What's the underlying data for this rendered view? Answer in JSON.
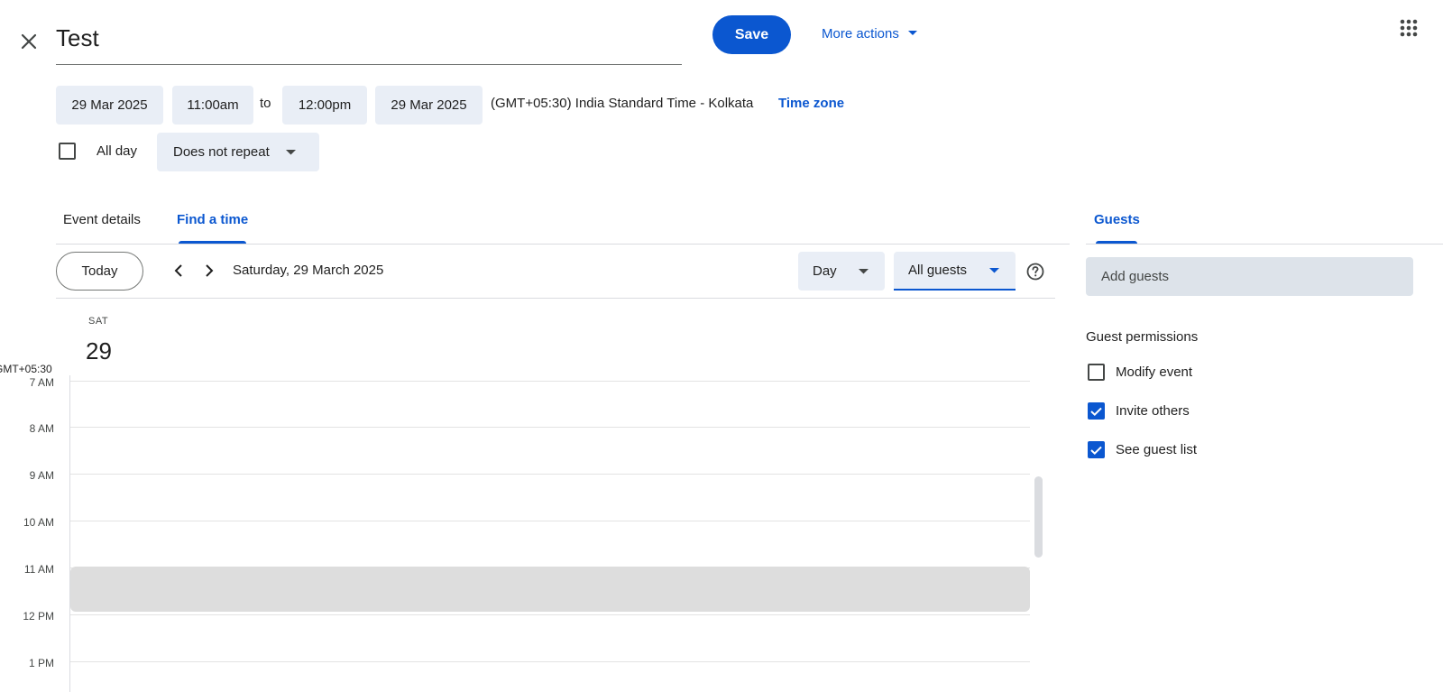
{
  "header": {
    "title_value": "Test",
    "save_label": "Save",
    "more_actions_label": "More actions"
  },
  "datetime": {
    "start_date": "29 Mar 2025",
    "start_time": "11:00am",
    "to_label": "to",
    "end_time": "12:00pm",
    "end_date": "29 Mar 2025",
    "timezone_text": "(GMT+05:30) India Standard Time - Kolkata",
    "timezone_link": "Time zone",
    "all_day_label": "All day",
    "all_day_checked": false,
    "repeat_value": "Does not repeat"
  },
  "tabs": [
    {
      "label": "Event details",
      "active": false
    },
    {
      "label": "Find a time",
      "active": true
    }
  ],
  "toolbar": {
    "today_label": "Today",
    "date_heading": "Saturday, 29 March 2025",
    "view_value": "Day",
    "guests_filter_value": "All guests"
  },
  "day_view": {
    "day_abbr": "SAT",
    "day_number": "29",
    "timezone_label": "GMT+05:30",
    "hours": [
      "7 AM",
      "8 AM",
      "9 AM",
      "10 AM",
      "11 AM",
      "12 PM",
      "1 PM"
    ],
    "busy_block": {
      "start": "11 AM",
      "end": "12 PM"
    }
  },
  "guests_panel": {
    "tab_label": "Guests",
    "add_guests_placeholder": "Add guests",
    "permissions_heading": "Guest permissions",
    "permissions": [
      {
        "label": "Modify event",
        "checked": false
      },
      {
        "label": "Invite others",
        "checked": true
      },
      {
        "label": "See guest list",
        "checked": true
      }
    ]
  },
  "colors": {
    "accent": "#0b57d0",
    "chip_bg": "#e9eef6",
    "busy_block": "#dddddd"
  },
  "icons": [
    "close-icon",
    "caret-down-icon",
    "apps-grid-icon",
    "chevron-left-icon",
    "chevron-right-icon",
    "help-icon",
    "checkmark-icon"
  ]
}
